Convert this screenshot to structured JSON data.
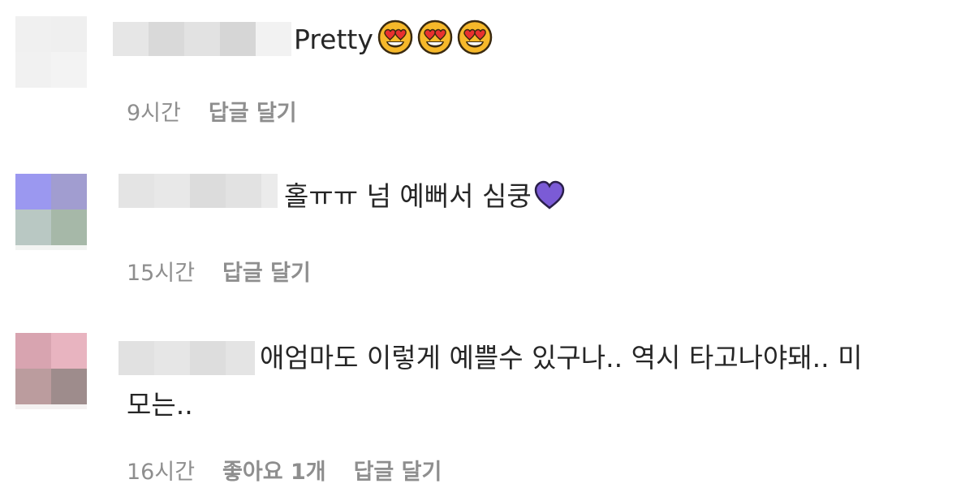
{
  "comments": [
    {
      "text": "Pretty",
      "emoji": [
        "smiling-face-with-heart-eyes",
        "smiling-face-with-heart-eyes",
        "smiling-face-with-heart-eyes"
      ],
      "time": "9시간",
      "reply_label": "답글 달기",
      "avatar_colors": [
        "#f0f0f0",
        "#efefef",
        "#f1f1f1",
        "#f3f3f3"
      ]
    },
    {
      "text": "홀ㅠㅠ 넘 예뻐서 심쿵",
      "emoji": [
        "purple-heart"
      ],
      "time": "15시간",
      "reply_label": "답글 달기",
      "avatar_colors": [
        "#9b98f0",
        "#a19dd0",
        "#b9c8c3",
        "#a6b8a8"
      ]
    },
    {
      "text_line1": "애엄마도 이렇게 예쁠수 있구나.. 역시 타고나야돼.. 미",
      "text_line2": "모는..",
      "time": "16시간",
      "likes_label": "좋아요 1개",
      "reply_label": "답글 달기",
      "avatar_colors": [
        "#d8a4b0",
        "#e8b4c0",
        "#bb9c9e",
        "#9e8c8c"
      ]
    }
  ],
  "colors": {
    "text": "#262626",
    "meta": "#8e8e8e",
    "heart_purple": "#7b5bd6",
    "emoji_yellow": "#fbc02d",
    "emoji_heart_red": "#e53935"
  }
}
